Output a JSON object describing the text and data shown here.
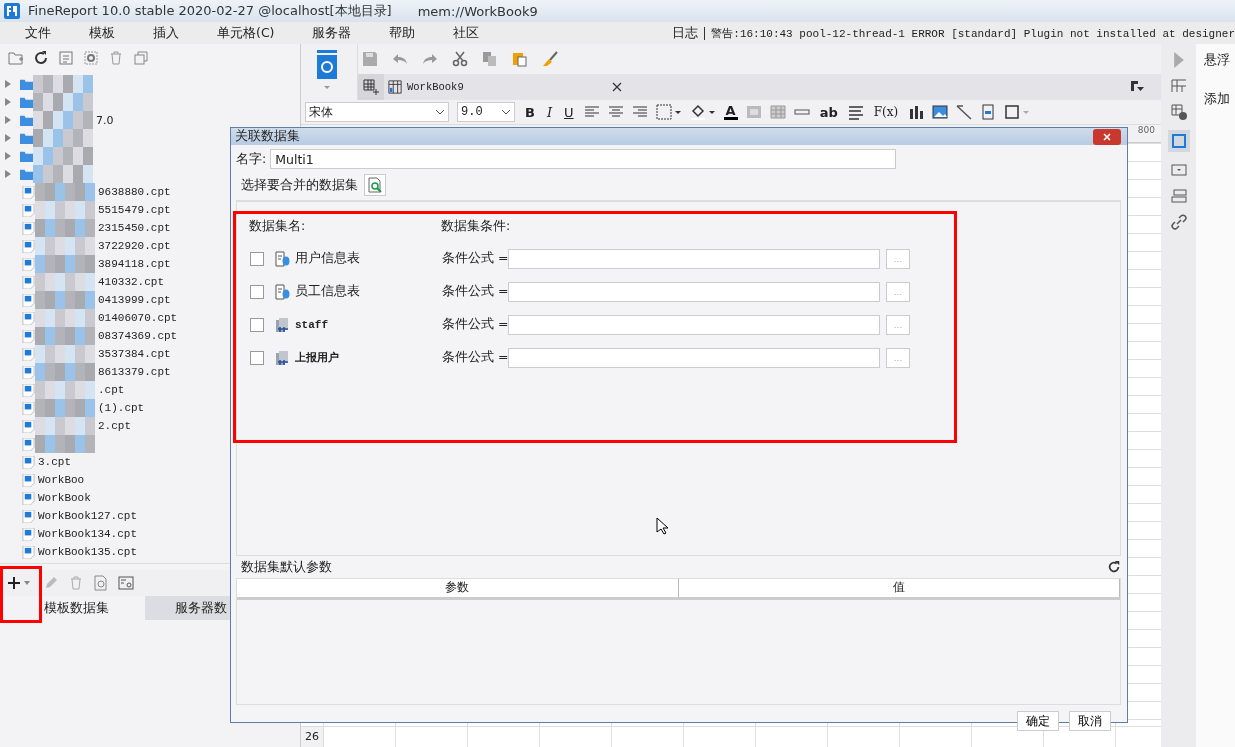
{
  "window": {
    "title": "FineReport 10.0 stable 2020-02-27 @localhost[本地目录]",
    "document": "mem://WorkBook9"
  },
  "menu": [
    "文件",
    "模板",
    "插入",
    "单元格(C)",
    "服务器",
    "帮助",
    "社区"
  ],
  "log": {
    "label": "日志",
    "message": "警告:16:10:43 pool-12-thread-1 ERROR [standard] Plugin not installed at designer"
  },
  "tree": {
    "folders": [
      {
        "masked": true
      },
      {
        "masked": true
      },
      {
        "masked": true,
        "label": "7.0"
      },
      {
        "masked": true
      },
      {
        "masked": true
      },
      {
        "masked": true
      }
    ],
    "files": [
      {
        "masked": true,
        "label": "9638880.cpt"
      },
      {
        "masked": true,
        "label": "5515479.cpt"
      },
      {
        "masked": true,
        "label": "2315450.cpt"
      },
      {
        "masked": true,
        "label": "3722920.cpt"
      },
      {
        "masked": true,
        "label": "3894118.cpt"
      },
      {
        "masked": true,
        "label": "410332.cpt"
      },
      {
        "masked": true,
        "label": "0413999.cpt"
      },
      {
        "masked": true,
        "label": "01406070.cpt"
      },
      {
        "masked": true,
        "label": "08374369.cpt"
      },
      {
        "masked": true,
        "label": "3537384.cpt"
      },
      {
        "masked": true,
        "label": "8613379.cpt"
      },
      {
        "masked": true,
        "label": ".cpt"
      },
      {
        "masked": true,
        "label": "(1).cpt"
      },
      {
        "masked": true,
        "label": "2.cpt"
      },
      {
        "masked": true
      },
      {
        "masked": false,
        "label": "3.cpt"
      },
      {
        "masked": false,
        "label": "WorkBoo"
      },
      {
        "masked": false,
        "label": "WorkBook"
      },
      {
        "masked": false,
        "label": "WorkBook127.cpt"
      },
      {
        "masked": false,
        "label": "WorkBook134.cpt"
      },
      {
        "masked": false,
        "label": "WorkBook135.cpt"
      }
    ]
  },
  "dataset_tabs": [
    {
      "label": "模板数据集",
      "selected": true
    },
    {
      "label": "服务器数",
      "selected": false
    }
  ],
  "editor": {
    "tab": "WorkBook9",
    "font": "宋体",
    "size": "9.0",
    "text_tools": [
      "B",
      "I",
      "U"
    ],
    "insert_tools": [
      "ab",
      "F(x)"
    ],
    "color_tool": "A",
    "column_label": "800",
    "row_label": "26"
  },
  "right_panel": {
    "title": "悬浮",
    "item": "添加"
  },
  "dialog": {
    "title": "关联数据集",
    "name_label": "名字:",
    "name_value": "Multi1",
    "select_label": "选择要合并的数据集",
    "col_name": "数据集名:",
    "col_condition": "数据集条件:",
    "datasets": [
      {
        "name": "用户信息表",
        "kind": "table",
        "checked": false,
        "condition": "条件公式 =",
        "more": "..."
      },
      {
        "name": "员工信息表",
        "kind": "table",
        "checked": false,
        "condition": "条件公式 =",
        "more": "..."
      },
      {
        "name": "staff",
        "kind": "database",
        "checked": false,
        "condition": "条件公式 =",
        "more": "..."
      },
      {
        "name": "上报用户",
        "kind": "database",
        "checked": false,
        "condition": "条件公式 =",
        "more": "..."
      }
    ],
    "params_title": "数据集默认参数",
    "params_columns": [
      "参数",
      "值"
    ],
    "buttons": [
      "确定",
      "取消"
    ]
  }
}
